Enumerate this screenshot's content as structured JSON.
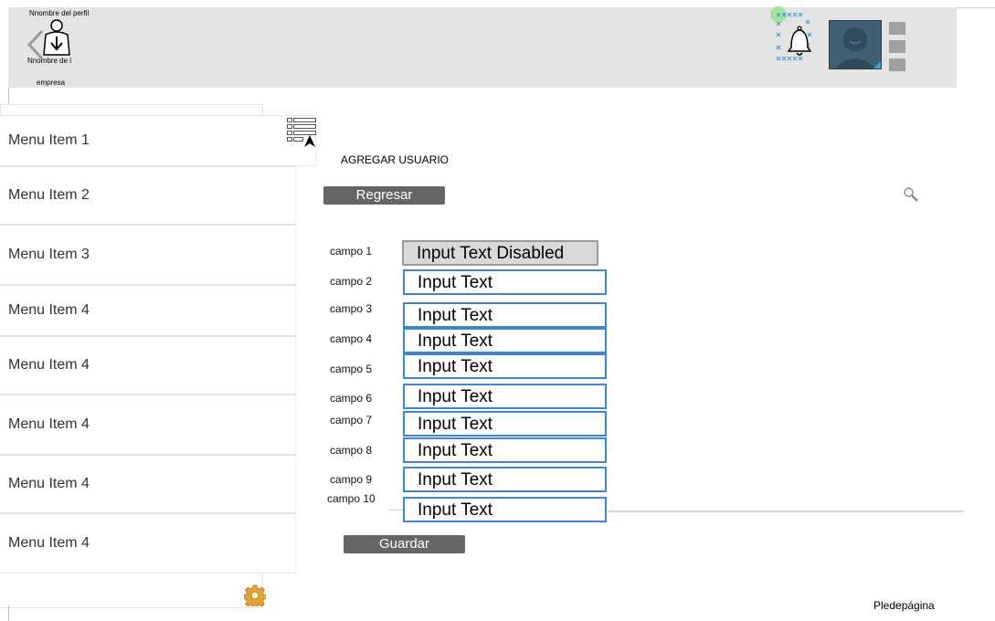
{
  "header": {
    "profile_name": "Nnombre del perfil",
    "company_line1": "Nnombre de l",
    "company_line2": "empresa"
  },
  "sidebar": {
    "items": [
      {
        "label": "Menu Item 1"
      },
      {
        "label": "Menu Item 2"
      },
      {
        "label": "Menu Item 3"
      },
      {
        "label": "Menu Item 4"
      },
      {
        "label": "Menu Item 4"
      },
      {
        "label": "Menu Item 4"
      },
      {
        "label": "Menu Item 4"
      },
      {
        "label": "Menu Item 4"
      }
    ]
  },
  "main": {
    "title": "AGREGAR USUARIO",
    "back_button": "Regresar",
    "save_button": "Guardar",
    "fields": [
      {
        "label": "campo 1",
        "value": "Input Text Disabled",
        "disabled": true
      },
      {
        "label": "campo 2",
        "value": "Input Text"
      },
      {
        "label": "campo 3",
        "value": "Input Text"
      },
      {
        "label": "campo 4",
        "value": "Input Text"
      },
      {
        "label": "campo 5",
        "value": "Input Text"
      },
      {
        "label": "campo 6",
        "value": "Input Text"
      },
      {
        "label": "campo 7",
        "value": "Input Text"
      },
      {
        "label": "campo 8",
        "value": "Input Text"
      },
      {
        "label": "campo 9",
        "value": "Input Text"
      },
      {
        "label": "campo 10",
        "value": "Input Text"
      }
    ]
  },
  "footer": {
    "text": "Pledepágina"
  },
  "icons": {
    "back": "chevron-left-icon",
    "profile": "profile-download-icon",
    "notifications": "bell-icon",
    "avatar": "avatar-icon",
    "menu": "hamburger-menu-icon",
    "list": "list-view-icon",
    "search": "search-icon",
    "settings": "gear-icon"
  },
  "colors": {
    "header_bg": "#e4e4e4",
    "button_bg": "#666666",
    "input_border": "#3b86d6",
    "disabled_bg": "#d9d9d9",
    "avatar_bg": "#3f5f72"
  }
}
